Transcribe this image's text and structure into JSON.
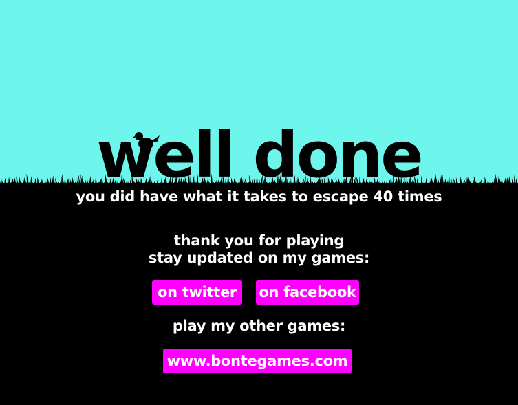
{
  "screen": {
    "title": "well done",
    "subtitle_prefix": "you did have what it takes to escape",
    "escape_count": "40",
    "subtitle_suffix": "times",
    "thanks_text": "thank you for playing",
    "stay_updated_text": "stay updated on my games:",
    "play_other_text": "play my other games:"
  },
  "buttons": {
    "twitter_label": "on twitter",
    "facebook_label": "on facebook",
    "website_label": "www.bontegames.com"
  },
  "colors": {
    "sky": "#6ff6ec",
    "ground": "#000000",
    "text": "#ffffff",
    "button": "#ff00ff"
  },
  "icons": {
    "bird": "bird-icon"
  }
}
